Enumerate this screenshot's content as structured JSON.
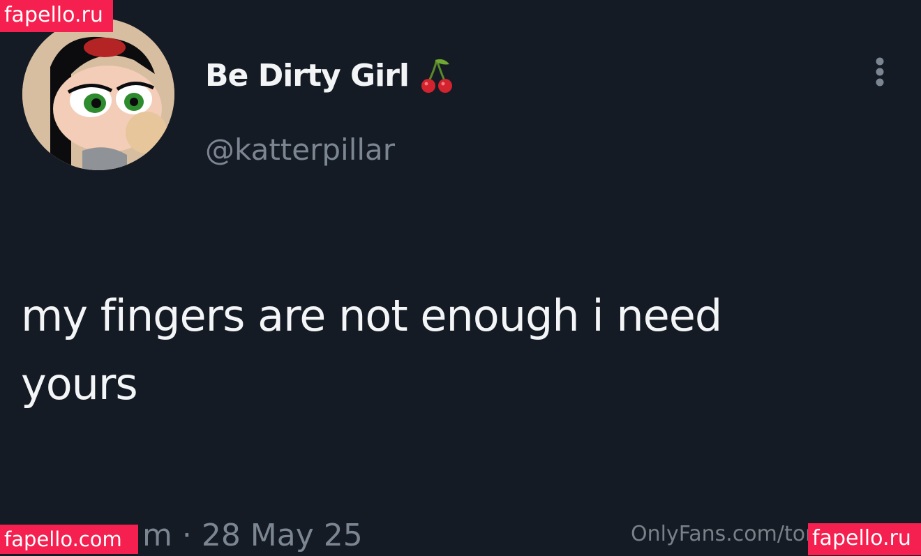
{
  "tweet": {
    "display_name": "Be Dirty Girl",
    "handle": "@katterpillar",
    "text": "my fingers are not enough i need yours",
    "meta": "m · 28 May 25"
  },
  "watermarks": {
    "top_left": "fapello.ru",
    "bottom_left": "fapello.com",
    "bottom_right": "fapello.ru",
    "onlyfans": "OnlyFans.com/tor"
  },
  "icons": {
    "name_badge": "cherry-icon",
    "menu": "more-vertical-icon",
    "avatar": "cartoon-avatar"
  },
  "colors": {
    "background": "#151b24",
    "primary_text": "#f4f5f7",
    "secondary_text": "#7c8692",
    "watermark_bg": "#f5204f"
  }
}
